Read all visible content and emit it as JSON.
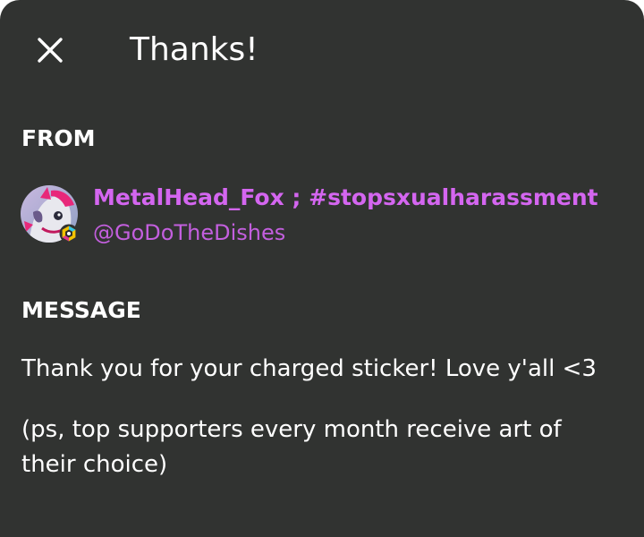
{
  "dialog": {
    "title": "Thanks!",
    "close_icon": "close-icon",
    "background_color": "#313331"
  },
  "from": {
    "label": "FROM",
    "display_name": "MetalHead_Fox ; #stopsxualharassment",
    "handle": "@GoDoTheDishes",
    "name_color": "#d466f0",
    "avatar_icon": "avatar-image",
    "badge_icon": "supporter-badge-icon"
  },
  "message": {
    "label": "MESSAGE",
    "line1": "Thank you for your charged sticker! Love y'all <3",
    "line2": "(ps, top supporters every month receive art of their choice)"
  }
}
